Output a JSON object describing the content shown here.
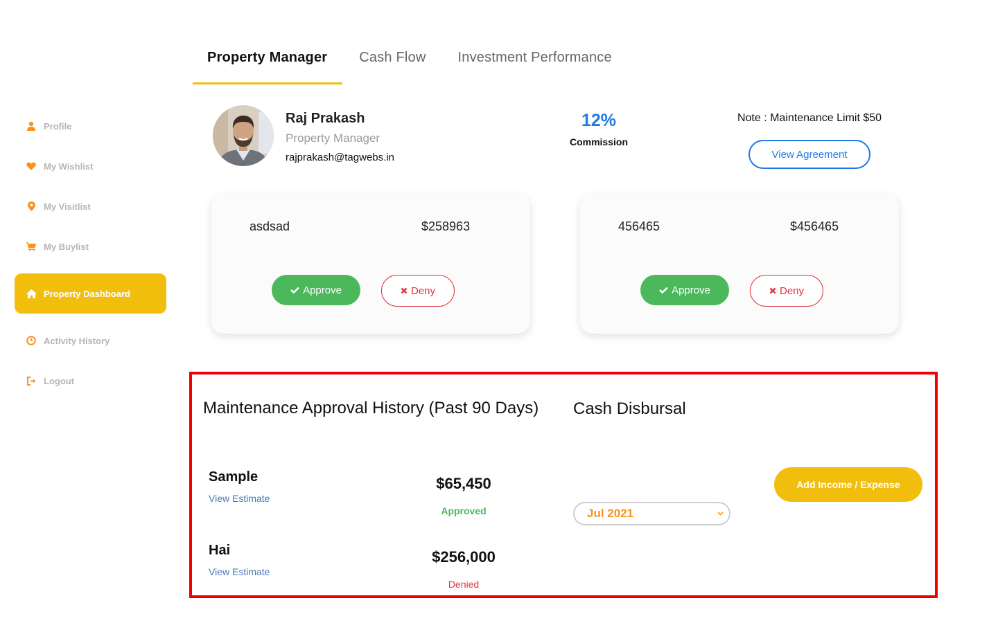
{
  "sidebar": {
    "items": [
      {
        "label": "Profile",
        "icon": "user-icon"
      },
      {
        "label": "My Wishlist",
        "icon": "heart-icon"
      },
      {
        "label": "My Visitlist",
        "icon": "map-pin-icon"
      },
      {
        "label": "My Buylist",
        "icon": "cart-icon"
      },
      {
        "label": "Property Dashboard",
        "icon": "home-icon",
        "active": true
      },
      {
        "label": "Activity History",
        "icon": "clock-icon"
      },
      {
        "label": "Logout",
        "icon": "logout-icon"
      }
    ]
  },
  "tabs": [
    {
      "label": "Property Manager",
      "active": true
    },
    {
      "label": "Cash Flow"
    },
    {
      "label": "Investment Performance"
    }
  ],
  "manager": {
    "name": "Raj Prakash",
    "role": "Property Manager",
    "email": "rajprakash@tagwebs.in",
    "commission_value": "12%",
    "commission_label": "Commission",
    "note": "Note : Maintenance Limit $50",
    "view_agreement_label": "View Agreement"
  },
  "requests": [
    {
      "description": "asdsad",
      "amount": "$258963",
      "approve_label": "Approve",
      "deny_label": "Deny"
    },
    {
      "description": "456465",
      "amount": "$456465",
      "approve_label": "Approve",
      "deny_label": "Deny"
    }
  ],
  "history": {
    "title": "Maintenance Approval History (Past 90 Days)",
    "items": [
      {
        "name": "Sample",
        "link": "View Estimate",
        "amount": "$65,450",
        "status": "Approved"
      },
      {
        "name": "Hai",
        "link": "View Estimate",
        "amount": "$256,000",
        "status": "Denied"
      }
    ]
  },
  "cash_disbursal": {
    "title": "Cash Disbursal",
    "add_button_label": "Add Income / Expense",
    "month_selected": "Jul 2021"
  },
  "colors": {
    "accent_yellow": "#f2be0e",
    "icon_orange": "#f7941d",
    "primary_blue": "#1e7ae6",
    "approve_green": "#4cb85c",
    "deny_red": "#e0333a",
    "highlight_red": "#ee0000"
  }
}
